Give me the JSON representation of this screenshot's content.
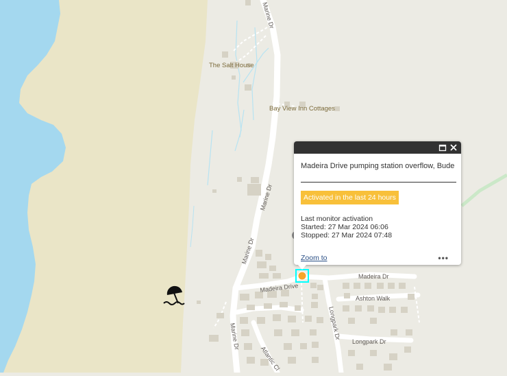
{
  "map": {
    "places": {
      "salt_house": "The Salt House",
      "bay_view": "Bay View Inn Cottages"
    },
    "roads": {
      "marine_dr_north": "Marine Dr",
      "marine_dr_mid": "Marine Dr",
      "marine_dr_lower": "Marine Dr",
      "marine_dr_south": "Marine Dr",
      "madeira_dr_west": "Madeira Drive",
      "madeira_dr_east": "Madeira Dr",
      "ashton_walk": "Ashton Walk",
      "longpark_dr_vertical": "Longpark Dr",
      "longpark_dr": "Longpark Dr",
      "atlantic_cl": "Atlantic Cl"
    },
    "icons": {
      "beach": "beach-umbrella-icon",
      "marker": "overflow-marker-icon",
      "maximize": "maximize-icon",
      "close": "close-icon"
    },
    "colors": {
      "sea": "#a4d8ef",
      "sand": "#eae5c7",
      "land": "#ecebe4",
      "road": "#ffffff",
      "building": "#d6d2c5",
      "path": "#b7e3f2",
      "marker": "#f8a52a",
      "badge": "#f8c03a",
      "cycle_route": "#cbe8c8"
    }
  },
  "popup": {
    "title": "Madeira Drive pumping station overflow, Bude",
    "status_badge": "Activated in the last 24 hours",
    "last_activation_label": "Last monitor activation",
    "started": "Started: 27 Mar 2024 06:06",
    "stopped": "Stopped: 27 Mar 2024 07:48",
    "zoom_link": "Zoom to",
    "more_menu": "•••"
  }
}
